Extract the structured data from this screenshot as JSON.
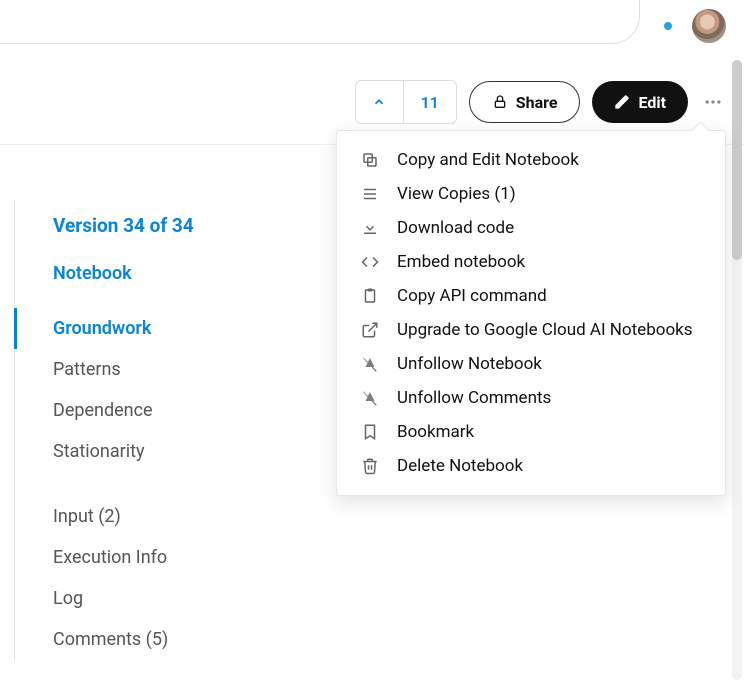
{
  "toolbar": {
    "version_number": "11",
    "share_label": "Share",
    "edit_label": "Edit"
  },
  "dropdown": {
    "items": [
      {
        "icon": "copy-icon",
        "label": "Copy and Edit Notebook"
      },
      {
        "icon": "list-icon",
        "label": "View Copies (1)"
      },
      {
        "icon": "download-icon",
        "label": "Download code"
      },
      {
        "icon": "embed-icon",
        "label": "Embed notebook"
      },
      {
        "icon": "clipboard-icon",
        "label": "Copy API command"
      },
      {
        "icon": "external-icon",
        "label": "Upgrade to Google Cloud AI Notebooks"
      },
      {
        "icon": "unfollow-icon",
        "label": "Unfollow Notebook"
      },
      {
        "icon": "unfollow-icon",
        "label": "Unfollow Comments"
      },
      {
        "icon": "bookmark-icon",
        "label": "Bookmark"
      },
      {
        "icon": "trash-icon",
        "label": "Delete Notebook"
      }
    ]
  },
  "sidebar": {
    "heading": "Version 34 of 34",
    "subheading": "Notebook",
    "sections": [
      {
        "label": "Groundwork",
        "active": true
      },
      {
        "label": "Patterns",
        "active": false
      },
      {
        "label": "Dependence",
        "active": false
      },
      {
        "label": "Stationarity",
        "active": false
      }
    ],
    "meta": [
      {
        "label": "Input (2)"
      },
      {
        "label": "Execution Info"
      },
      {
        "label": "Log"
      },
      {
        "label": "Comments  (5)"
      }
    ]
  }
}
